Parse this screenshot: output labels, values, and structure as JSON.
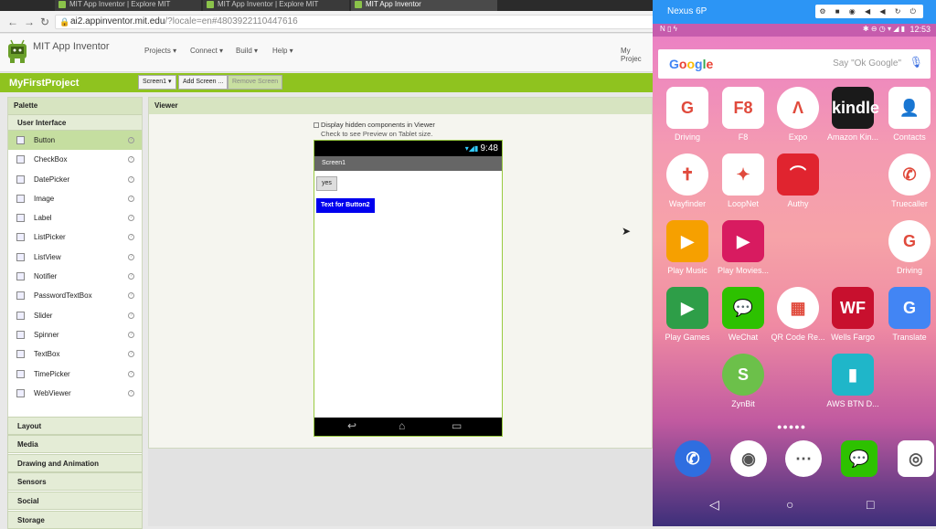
{
  "browser": {
    "tabs": [
      {
        "label": "MIT App Inventor | Explore MIT"
      },
      {
        "label": "MIT App Inventor | Explore MIT"
      },
      {
        "label": "MIT App Inventor"
      }
    ],
    "url_host": "ai2.appinventor.mit.edu",
    "url_rest": "/?locale=en#4803922110447616",
    "icons": [
      "back-icon",
      "forward-icon",
      "reload-icon",
      "lock-icon"
    ]
  },
  "app": {
    "brand": "MIT App Inventor",
    "menus": [
      "Projects ▾",
      "Connect ▾",
      "Build ▾",
      "Help ▾"
    ],
    "my_projects": "My Projec",
    "project_name": "MyFirstProject",
    "screen_button": "Screen1 ▾",
    "add_screen": "Add Screen ...",
    "remove_screen": "Remove Screen",
    "accent_color": "#8fc31f"
  },
  "palette": {
    "title": "Palette",
    "section": "User Interface",
    "items": [
      "Button",
      "CheckBox",
      "DatePicker",
      "Image",
      "Label",
      "ListPicker",
      "ListView",
      "Notifier",
      "PasswordTextBox",
      "Slider",
      "Spinner",
      "TextBox",
      "TimePicker",
      "WebViewer"
    ],
    "categories": [
      "Layout",
      "Media",
      "Drawing and Animation",
      "Sensors",
      "Social",
      "Storage"
    ]
  },
  "viewer": {
    "title": "Viewer",
    "hidden_label": "Display hidden components in Viewer",
    "tablet_label": "Check to see Preview on Tablet size.",
    "phone_time": "9:48",
    "screen_title": "Screen1",
    "button1": "yes",
    "button2": "Text for Button2"
  },
  "emulator": {
    "device": "Nexus 6P",
    "toolbar": "⚙ ■ ◉ ◀ ◀ ↻ ⏻",
    "time": "12:53",
    "google": "Google",
    "say": "Say \"Ok Google\"",
    "apps": [
      {
        "label": "Driving",
        "color": "#ffffff",
        "glyph": "G"
      },
      {
        "label": "F8",
        "color": "#ffffff",
        "glyph": "F8"
      },
      {
        "label": "Expo",
        "color": "#ffffff",
        "glyph": "Λ"
      },
      {
        "label": "Amazon Kin...",
        "color": "#1a1a1a",
        "glyph": "kindle"
      },
      {
        "label": "Contacts",
        "color": "#ffffff",
        "glyph": "👤"
      },
      {
        "label": "Wayfinder",
        "color": "#ffffff",
        "glyph": "✝"
      },
      {
        "label": "LoopNet",
        "color": "#ffffff",
        "glyph": "✦"
      },
      {
        "label": "Authy",
        "color": "#e0242f",
        "glyph": "⌒"
      },
      {
        "label": "Truecaller",
        "color": "#ffffff",
        "glyph": "✆"
      },
      {
        "label": "Play Music",
        "color": "#f6a000",
        "glyph": "▶"
      },
      {
        "label": "Play Movies...",
        "color": "#d81b60",
        "glyph": "▶"
      },
      {
        "label": "Driving",
        "color": "#ffffff",
        "glyph": "G"
      },
      {
        "label": "Play Games",
        "color": "#2e9e48",
        "glyph": "▶"
      },
      {
        "label": "WeChat",
        "color": "#2dc100",
        "glyph": "💬"
      },
      {
        "label": "QR Code Re...",
        "color": "#ffffff",
        "glyph": "▦"
      },
      {
        "label": "Wells Fargo",
        "color": "#c8102e",
        "glyph": "WF"
      },
      {
        "label": "Translate",
        "color": "#4285f4",
        "glyph": "G"
      },
      {
        "label": "ZynBit",
        "color": "#6cc04a",
        "glyph": "S"
      },
      {
        "label": "AWS BTN D...",
        "color": "#1fb6c9",
        "glyph": "▮"
      }
    ],
    "dock": [
      {
        "color": "#2f6ee0",
        "glyph": "✆"
      },
      {
        "color": "#ffffff",
        "glyph": "◉"
      },
      {
        "color": "#ffffff",
        "glyph": "⋯"
      },
      {
        "color": "#2dc100",
        "glyph": "💬"
      },
      {
        "color": "#ffffff",
        "glyph": "◎"
      }
    ]
  }
}
